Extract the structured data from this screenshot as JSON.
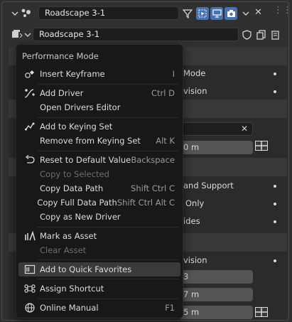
{
  "outliner_header": {
    "object_name": "Roadscape 3-1",
    "close_glyph": "✕"
  },
  "data_header": {
    "object_name": "Roadscape 3-1"
  },
  "background": {
    "row1_text": "Mode",
    "row2_text": "vision",
    "field_value_1": "0 m",
    "row3_text": "and Support",
    "row4_text": "Only",
    "row5_text": "ides",
    "row6_text": "vision",
    "field_value_2": "3",
    "field_value_3": "7 m",
    "field_value_4": "5 m",
    "clear_glyph": "✕"
  },
  "context_menu": {
    "title": "Performance Mode",
    "items": [
      {
        "label": "Insert Keyframe",
        "shortcut": "I",
        "icon": "keyframe-icon",
        "disabled": false
      },
      {
        "label": "Add Driver",
        "shortcut": "Ctrl D",
        "icon": "driver-icon",
        "disabled": false
      },
      {
        "label": "Open Drivers Editor",
        "shortcut": "",
        "icon": "",
        "disabled": false
      },
      {
        "label": "Add to Keying Set",
        "shortcut": "",
        "icon": "keying-set-icon",
        "disabled": false
      },
      {
        "label": "Remove from Keying Set",
        "shortcut": "Alt K",
        "icon": "",
        "disabled": false
      },
      {
        "label": "Reset to Default Value",
        "shortcut": "Backspace",
        "icon": "reset-icon",
        "disabled": false
      },
      {
        "label": "Copy to Selected",
        "shortcut": "",
        "icon": "",
        "disabled": true
      },
      {
        "label": "Copy Data Path",
        "shortcut": "Shift Ctrl C",
        "icon": "",
        "disabled": false
      },
      {
        "label": "Copy Full Data Path",
        "shortcut": "Shift Ctrl Alt C",
        "icon": "",
        "disabled": false
      },
      {
        "label": "Copy as New Driver",
        "shortcut": "",
        "icon": "",
        "disabled": false
      },
      {
        "label": "Mark as Asset",
        "shortcut": "",
        "icon": "asset-icon",
        "disabled": false
      },
      {
        "label": "Clear Asset",
        "shortcut": "",
        "icon": "",
        "disabled": true
      },
      {
        "label": "Add to Quick Favorites",
        "shortcut": "",
        "icon": "quick-favorites-icon",
        "disabled": false
      },
      {
        "label": "Assign Shortcut",
        "shortcut": "",
        "icon": "shortcut-icon",
        "disabled": false
      },
      {
        "label": "Online Manual",
        "shortcut": "F1",
        "icon": "globe-icon",
        "disabled": false
      }
    ]
  },
  "colors": {
    "accent_blue": "#4772b3",
    "menu_bg": "#181818",
    "highlight": "#3a3a3a"
  }
}
